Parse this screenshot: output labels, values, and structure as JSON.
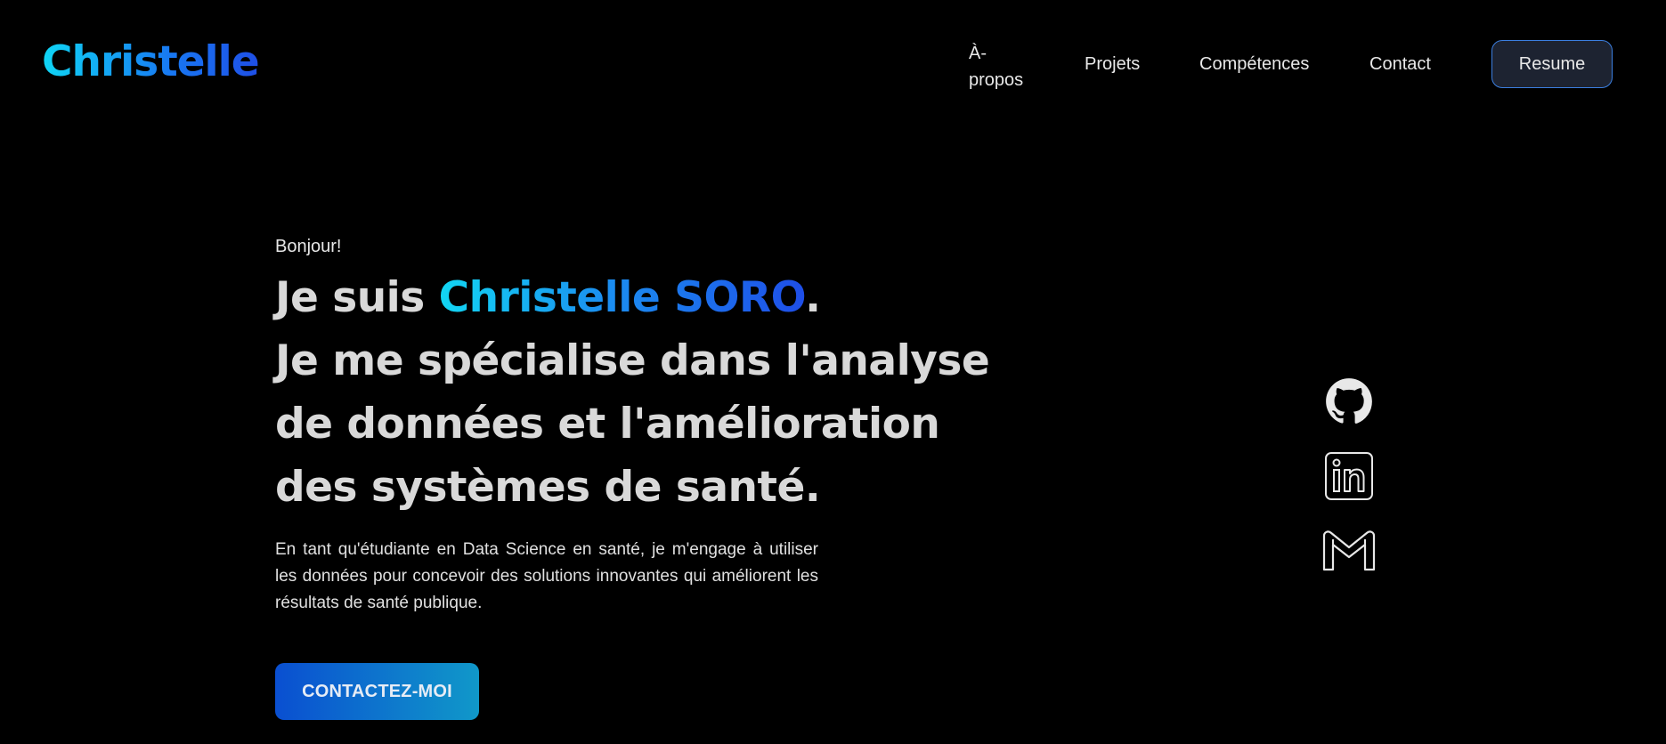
{
  "header": {
    "logo": "Christelle",
    "nav": [
      {
        "label": "À-propos"
      },
      {
        "label": "Projets"
      },
      {
        "label": "Compétences"
      },
      {
        "label": "Contact"
      }
    ],
    "resume_label": "Resume"
  },
  "hero": {
    "greeting": "Bonjour!",
    "headline_prefix": "Je suis ",
    "name": "Christelle SORO",
    "headline_dot": ".",
    "headline_rest": "Je me spécialise dans l'analyse de données et l'amélioration des systèmes de santé.",
    "intro": "En tant qu'étudiante en Data Science en santé, je m'engage à utiliser les données pour concevoir des solutions innovantes qui améliorent les résultats de santé publique.",
    "cta_label": "CONTACTEZ-MOI"
  },
  "social": [
    {
      "icon": "github-icon"
    },
    {
      "icon": "linkedin-icon"
    },
    {
      "icon": "gmail-icon"
    }
  ],
  "colors": {
    "background": "#000000",
    "accent_start": "#0fd6f5",
    "accent_end": "#1f4fe6",
    "resume_border": "#3b7fe0"
  }
}
